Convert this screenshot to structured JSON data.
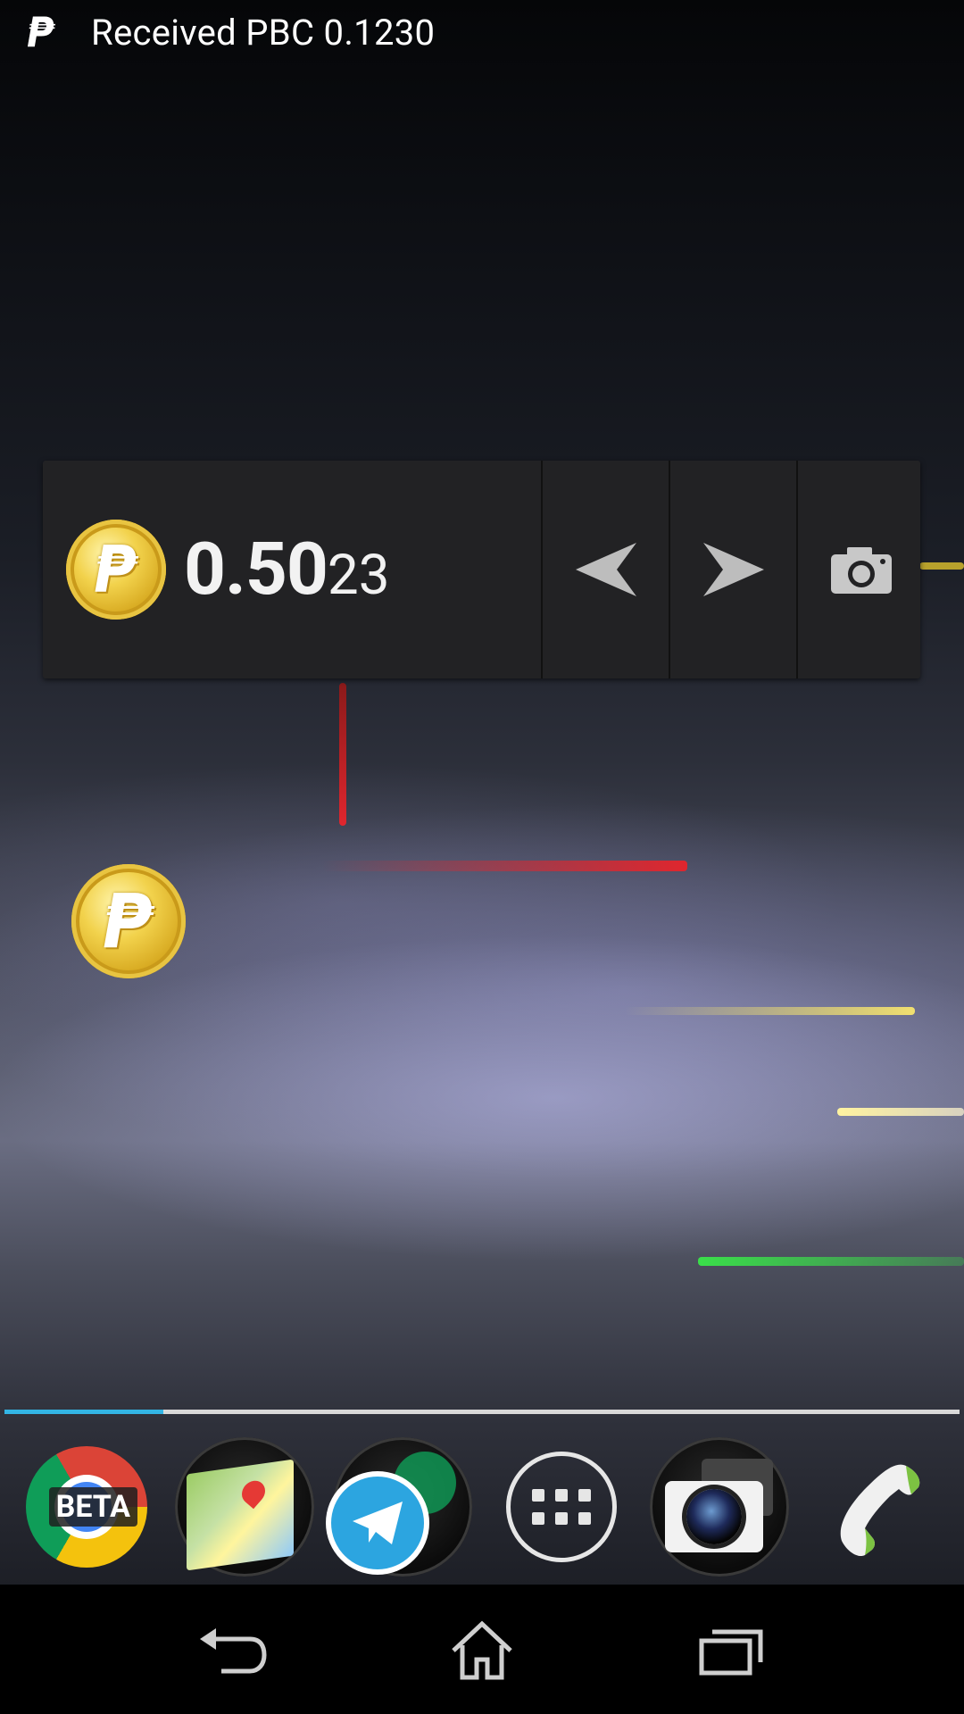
{
  "status_bar": {
    "notification_icon": "peercoin-logo-icon",
    "notification_text": "Received PBC 0.1230"
  },
  "widget": {
    "coin_icon": "peercoin-coin-icon",
    "balance_main": "0.50",
    "balance_minor": "23",
    "buttons": [
      {
        "name": "request-button",
        "icon": "receive-arrow-icon"
      },
      {
        "name": "send-button",
        "icon": "send-arrow-icon"
      },
      {
        "name": "scan-button",
        "icon": "camera-icon"
      }
    ]
  },
  "home_shortcut": {
    "icon": "peercoin-coin-icon"
  },
  "dock": {
    "items": [
      {
        "name": "chrome-beta",
        "label": "BETA",
        "icon": "chrome-icon"
      },
      {
        "name": "folder-maps",
        "icon": "maps-icon"
      },
      {
        "name": "folder-telegram",
        "icon": "telegram-icon"
      },
      {
        "name": "app-drawer",
        "icon": "apps-grid-icon"
      },
      {
        "name": "folder-camera",
        "icon": "camera-icon"
      },
      {
        "name": "phone",
        "icon": "phone-icon"
      }
    ]
  },
  "nav_bar": {
    "buttons": [
      "back",
      "home",
      "recents"
    ]
  },
  "colors": {
    "page_indicator_active": "#33b5e5",
    "widget_bg": "#222224",
    "coin_gold": "#f2d24c"
  }
}
